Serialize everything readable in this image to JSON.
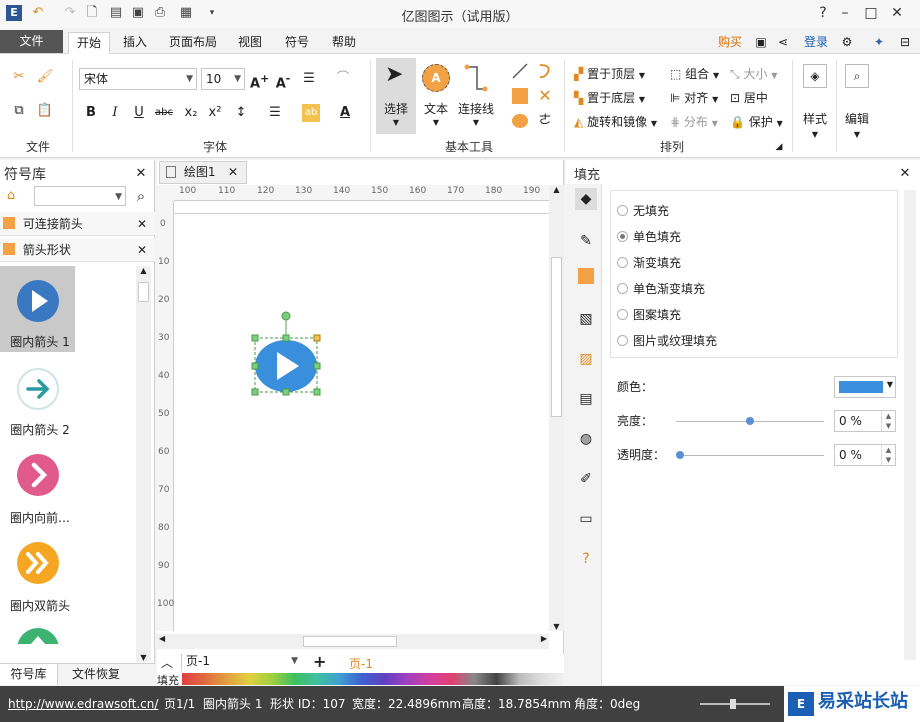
{
  "app": {
    "title": "亿图图示（试用版）"
  },
  "menu_tabs": [
    "文件",
    "开始",
    "插入",
    "页面布局",
    "视图",
    "符号",
    "帮助"
  ],
  "menu_right": {
    "buy": "购买",
    "login": "登录"
  },
  "ribbon": {
    "file_group": "文件",
    "font_group": "字体",
    "font_name": "宋体",
    "font_size": "10",
    "basic_tools_group": "基本工具",
    "select_label": "选择",
    "text_label": "文本",
    "connector_label": "连接线",
    "arrange_group": "排列",
    "bring_top": "置于顶层",
    "send_bottom": "置于底层",
    "rotate_mirror": "旋转和镜像",
    "group": "组合",
    "align": "对齐",
    "distribute": "分布",
    "size": "大小",
    "center": "居中",
    "protect": "保护",
    "style": "样式",
    "edit": "编辑"
  },
  "left_panel": {
    "title": "符号库",
    "libraries": [
      "可连接箭头",
      "箭头形状"
    ],
    "symbols": [
      "圈内箭头 1",
      "圈内箭头 2",
      "圈内向前…",
      "圈内双箭头"
    ],
    "bottom_tabs": [
      "符号库",
      "文件恢复"
    ]
  },
  "canvas": {
    "doc_tab": "绘图1",
    "ruler_top": [
      "100",
      "110",
      "120",
      "130",
      "140",
      "150",
      "160",
      "170",
      "180",
      "190"
    ],
    "ruler_left": [
      "0",
      "10",
      "20",
      "30",
      "40",
      "50",
      "60",
      "70",
      "80",
      "90",
      "100"
    ],
    "page_selector": "页-1",
    "page_tab": "页-1",
    "fill_label": "填充"
  },
  "right_panel": {
    "title": "填充",
    "options": [
      "无填充",
      "单色填充",
      "渐变填充",
      "单色渐变填充",
      "图案填充",
      "图片或纹理填充"
    ],
    "selected_index": 1,
    "color_label": "颜色：",
    "color_value": "#3b8fdc",
    "brightness_label": "亮度：",
    "brightness_value": "0 %",
    "transparency_label": "透明度：",
    "transparency_value": "0 %"
  },
  "status": {
    "url": "http://www.edrawsoft.cn/",
    "page": "页1/1",
    "shape_name": "圈内箭头 1",
    "shape_id": "形状 ID：107",
    "width": "宽度：22.4896mm",
    "height": "高度：18.7854mm",
    "angle": "角度：0deg",
    "watermark": "易采站长站"
  }
}
